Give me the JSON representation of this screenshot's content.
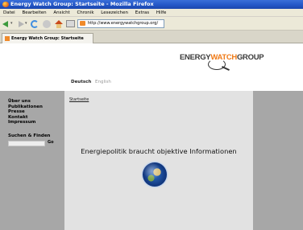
{
  "window": {
    "title": "Energy Watch Group: Startseite - Mozilla Firefox"
  },
  "menu": [
    "Datei",
    "Bearbeiten",
    "Ansicht",
    "Chronik",
    "Lesezeichen",
    "Extras",
    "Hilfe"
  ],
  "toolbar": {
    "url": "http://www.energywatchgroup.org/"
  },
  "tabs": [
    {
      "label": "Energy Watch Group: Startseite",
      "close_glyph": "×"
    }
  ],
  "site": {
    "logo": {
      "part1": "ENERGY",
      "part2": "WATCH",
      "part3": "GROUP"
    },
    "languages": {
      "active": "Deutsch",
      "other": "English"
    },
    "nav": [
      "Über uns",
      "Publikationen",
      "Presse",
      "Kontakt",
      "Impressum"
    ],
    "search": {
      "heading": "Suchen & Finden",
      "button": "Go",
      "value": ""
    },
    "breadcrumb": "Startseite",
    "headline": "Energiepolitik braucht objektive Informationen"
  },
  "colors": {
    "titlebar": "#2457c8",
    "logo_accent": "#f07b18",
    "sidebar": "#a7a7a7",
    "content_bg": "#e2e2e2"
  }
}
